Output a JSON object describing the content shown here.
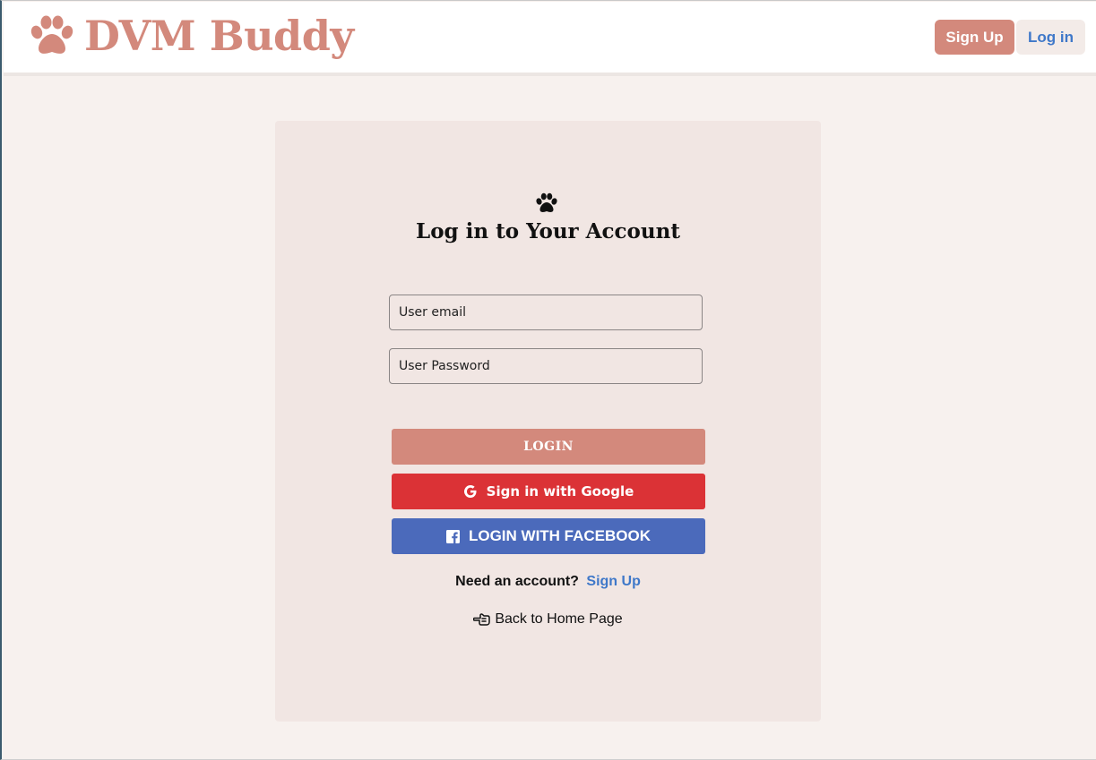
{
  "header": {
    "brand_name": "DVM Buddy",
    "brand_icon": "paw-icon",
    "signup_label": "Sign Up",
    "login_label": "Log in"
  },
  "card": {
    "icon": "paw-icon",
    "title": "Log in to Your Account",
    "email_placeholder": "User email",
    "password_placeholder": "User Password",
    "login_button": "LOGIN",
    "google_button": "Sign in with Google",
    "google_icon": "google-icon",
    "facebook_button": "LOGIN WITH FACEBOOK",
    "facebook_icon": "facebook-icon",
    "need_account_text": "Need an account?",
    "signup_link": "Sign Up",
    "back_home": "Back to Home Page",
    "back_icon": "pointing-hand-icon"
  },
  "colors": {
    "brand": "#d3897c",
    "link": "#3f78c9",
    "google": "#db3236",
    "facebook": "#4b6abb",
    "page_bg": "#f7f1ee",
    "card_bg": "#f1e6e3"
  }
}
